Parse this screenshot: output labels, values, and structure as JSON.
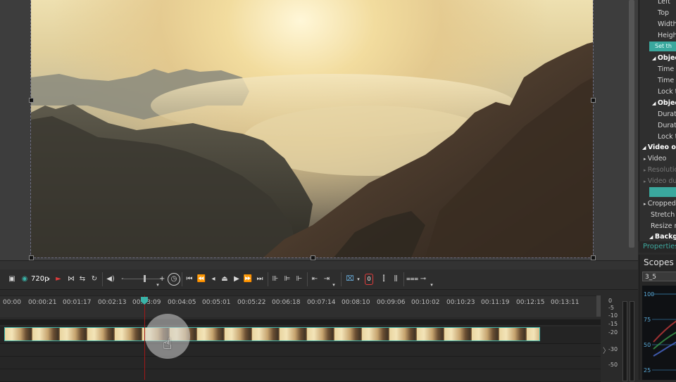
{
  "properties": {
    "rows": [
      {
        "label": "Left",
        "type": "item"
      },
      {
        "label": "Top",
        "type": "item"
      },
      {
        "label": "Width",
        "type": "item"
      },
      {
        "label": "Height",
        "type": "item"
      },
      {
        "label": "Set th",
        "type": "button"
      },
      {
        "label": "Object",
        "type": "header"
      },
      {
        "label": "Time (",
        "type": "item"
      },
      {
        "label": "Time (",
        "type": "item"
      },
      {
        "label": "Lock to",
        "type": "item"
      },
      {
        "label": "Object",
        "type": "header"
      },
      {
        "label": "Duratio",
        "type": "item"
      },
      {
        "label": "Duratio",
        "type": "item"
      },
      {
        "label": "Lock to",
        "type": "item"
      },
      {
        "label": "Video ob",
        "type": "header-top"
      },
      {
        "label": "Video",
        "type": "item-arrow"
      },
      {
        "label": "Resolutio",
        "type": "disabled"
      },
      {
        "label": "Video du",
        "type": "disabled"
      },
      {
        "label": "",
        "type": "button"
      },
      {
        "label": "Cropped",
        "type": "item-arrow"
      },
      {
        "label": "Stretch vi",
        "type": "item"
      },
      {
        "label": "Resize me",
        "type": "item"
      },
      {
        "label": "Backg",
        "type": "header"
      }
    ],
    "tab_label": "Properties"
  },
  "scopes": {
    "title": "Scopes",
    "selected": "3_5",
    "ticks": [
      "100",
      "75",
      "50",
      "25"
    ]
  },
  "toolbar": {
    "resolution": "720p"
  },
  "timeline": {
    "ruler_labels": [
      "00:00",
      "00:00:21",
      "00:01:17",
      "00:02:13",
      "00:03:09",
      "00:04:05",
      "00:05:01",
      "00:05:22",
      "00:06:18",
      "00:07:14",
      "00:08:10",
      "00:09:06",
      "00:10:02",
      "00:10:23",
      "00:11:19",
      "00:12:15",
      "00:13:11"
    ]
  },
  "audio_meter": {
    "db_labels": [
      "0",
      "-5",
      "-10",
      "-15",
      "-20",
      "-30",
      "-50"
    ]
  },
  "colors": {
    "accent": "#3ab3a8",
    "playhead": "#a01818"
  }
}
